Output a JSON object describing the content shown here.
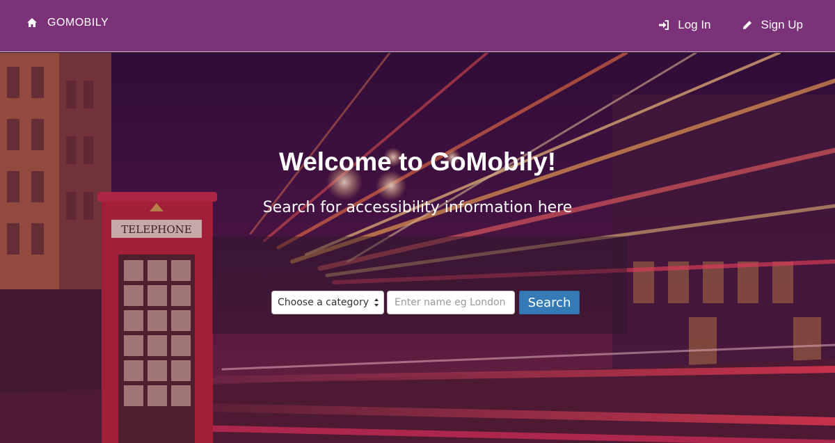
{
  "navbar": {
    "brand_label": "GOMOBILY",
    "brand_icon": "home-icon",
    "login_label": "Log In",
    "login_icon": "sign-in-icon",
    "signup_label": "Sign Up",
    "signup_icon": "pencil-icon",
    "background_color": "#7c3279"
  },
  "hero": {
    "title": "Welcome to GoMobily!",
    "subtitle": "Search for accessibility information here",
    "phone_box_sign": "TELEPHONE"
  },
  "search": {
    "category_selected": "Choose a category",
    "name_placeholder": "Enter name eg London",
    "name_value": "",
    "button_label": "Search",
    "button_color": "#337ab7"
  }
}
